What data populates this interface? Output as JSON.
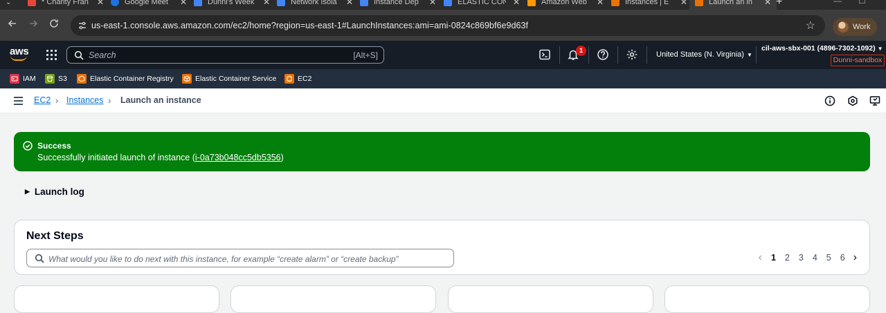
{
  "browser": {
    "tabs": [
      {
        "title": "* Charity Fran",
        "favicon_color": "#e8453c"
      },
      {
        "title": "Google Meet",
        "favicon_color": "#1a73e8"
      },
      {
        "title": "Dunni's Week",
        "favicon_color": "#4285f4"
      },
      {
        "title": "Network Isola",
        "favicon_color": "#4285f4"
      },
      {
        "title": "Instance Dep",
        "favicon_color": "#4285f4"
      },
      {
        "title": "ELASTIC CON",
        "favicon_color": "#4285f4"
      },
      {
        "title": "Amazon Web",
        "favicon_color": "#ff9900"
      },
      {
        "title": "Instances | E",
        "favicon_color": "#ed7100"
      },
      {
        "title": "Launch an in",
        "favicon_color": "#ed7100"
      }
    ],
    "url": "us-east-1.console.aws.amazon.com/ec2/home?region=us-east-1#LaunchInstances:ami=ami-0824c869bf6e9d63f",
    "profile_label": "Work"
  },
  "aws_header": {
    "logo_text": "aws",
    "search_placeholder": "Search",
    "search_shortcut": "[Alt+S]",
    "notification_count": "1",
    "region": "United States (N. Virginia)",
    "account": "cil-aws-sbx-001 (4896-7302-1092)",
    "role_badge": "Dunni-sandbox"
  },
  "favorites": [
    {
      "label": "IAM",
      "icon": "iam-icon",
      "color": "#dd344c"
    },
    {
      "label": "S3",
      "icon": "s3-icon",
      "color": "#7aa116"
    },
    {
      "label": "Elastic Container Registry",
      "icon": "ecr-icon",
      "color": "#ed7100"
    },
    {
      "label": "Elastic Container Service",
      "icon": "ecs-icon",
      "color": "#ed7100"
    },
    {
      "label": "EC2",
      "icon": "ec2-icon",
      "color": "#ed7100"
    }
  ],
  "breadcrumb": {
    "items": [
      "EC2",
      "Instances"
    ],
    "current": "Launch an instance"
  },
  "flash": {
    "title": "Success",
    "message_prefix": "Successfully initiated launch of instance (",
    "instance_id": "i-0a73b048cc5db5356",
    "message_suffix": ")"
  },
  "launch_log": {
    "label": "Launch log"
  },
  "next_steps": {
    "title": "Next Steps",
    "filter_placeholder": "What would you like to do next with this instance, for example “create alarm” or “create backup”",
    "pages": [
      "1",
      "2",
      "3",
      "4",
      "5",
      "6"
    ],
    "current_page": "1"
  }
}
